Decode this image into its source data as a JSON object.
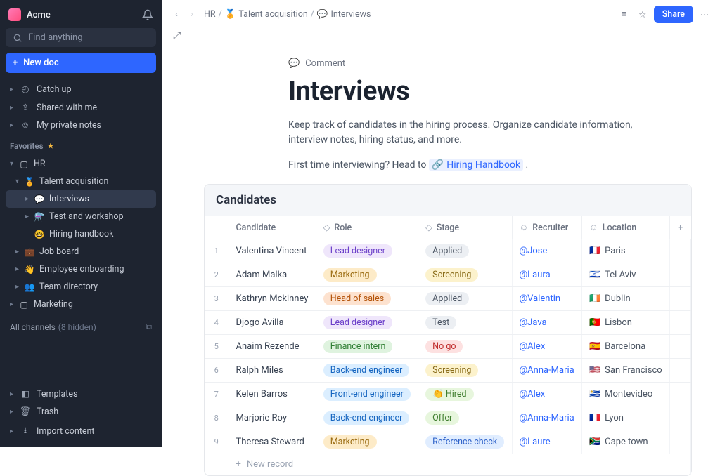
{
  "workspace": {
    "name": "Acme"
  },
  "search": {
    "placeholder": "Find anything"
  },
  "new_doc_label": "New doc",
  "nav": {
    "catch_up": "Catch up",
    "shared": "Shared with me",
    "private": "My private notes"
  },
  "favorites_label": "Favorites",
  "tree": {
    "hr": "HR",
    "talent": "Talent acquisition",
    "interviews": "Interviews",
    "test_workshop": "Test and workshop",
    "hiring_handbook": "Hiring handbook",
    "job_board": "Job board",
    "onboarding": "Employee onboarding",
    "team_directory": "Team directory",
    "marketing": "Marketing"
  },
  "all_channels": {
    "label": "All channels",
    "hidden": "(8 hidden)"
  },
  "footer": {
    "templates": "Templates",
    "trash": "Trash",
    "import": "Import content"
  },
  "breadcrumbs": {
    "seg1": "HR",
    "seg2": "Talent acquisition",
    "seg3": "Interviews"
  },
  "share_label": "Share",
  "comment_label": "Comment",
  "doc_title": "Interviews",
  "doc_desc": "Keep track of candidates in the hiring process. Organize candidate information, interview notes, hiring status, and more.",
  "hint_prefix": "First time interviewing? Head to ",
  "hint_link": "Hiring Handbook",
  "table_title": "Candidates",
  "columns": {
    "candidate": "Candidate",
    "role": "Role",
    "stage": "Stage",
    "recruiter": "Recruiter",
    "location": "Location"
  },
  "rows": [
    {
      "n": "1",
      "name": "Valentina Vincent",
      "role": "Lead designer",
      "role_c": "tag-purple",
      "stage": "Applied",
      "stage_c": "tag-gray",
      "recruiter": "@Jose",
      "flag": "🇫🇷",
      "loc": "Paris"
    },
    {
      "n": "2",
      "name": "Adam Malka",
      "role": "Marketing",
      "role_c": "tag-yellow",
      "stage": "Screening",
      "stage_c": "tag-lyellow",
      "recruiter": "@Laura",
      "flag": "🇮🇱",
      "loc": "Tel Aviv"
    },
    {
      "n": "3",
      "name": "Kathryn Mckinney",
      "role": "Head of sales",
      "role_c": "tag-orange",
      "stage": "Applied",
      "stage_c": "tag-gray",
      "recruiter": "@Valentin",
      "flag": "🇮🇪",
      "loc": "Dublin"
    },
    {
      "n": "4",
      "name": "Djogo Avilla",
      "role": "Lead designer",
      "role_c": "tag-purple",
      "stage": "Test",
      "stage_c": "tag-gray",
      "recruiter": "@Java",
      "flag": "🇵🇹",
      "loc": "Lisbon"
    },
    {
      "n": "5",
      "name": "Anaim Rezende",
      "role": "Finance intern",
      "role_c": "tag-green",
      "stage": "No go",
      "stage_c": "tag-red",
      "recruiter": "@Alex",
      "flag": "🇪🇸",
      "loc": "Barcelona"
    },
    {
      "n": "6",
      "name": "Ralph Miles",
      "role": "Back-end engineer",
      "role_c": "tag-blue",
      "stage": "Screening",
      "stage_c": "tag-lyellow",
      "recruiter": "@Anna-Maria",
      "flag": "🇺🇸",
      "loc": "San Francisco"
    },
    {
      "n": "7",
      "name": "Kelen Barros",
      "role": "Front-end engineer",
      "role_c": "tag-blue",
      "stage": "👏 Hired",
      "stage_c": "tag-lgreen",
      "recruiter": "@Alex",
      "flag": "🇺🇾",
      "loc": "Montevideo"
    },
    {
      "n": "8",
      "name": "Marjorie Roy",
      "role": "Back-end engineer",
      "role_c": "tag-blue",
      "stage": "Offer",
      "stage_c": "tag-lgreen",
      "recruiter": "@Anna-Maria",
      "flag": "🇫🇷",
      "loc": "Lyon"
    },
    {
      "n": "9",
      "name": "Theresa Steward",
      "role": "Marketing",
      "role_c": "tag-yellow",
      "stage": "Reference check",
      "stage_c": "tag-lblue",
      "recruiter": "@Laure",
      "flag": "🇿🇦",
      "loc": "Cape town"
    }
  ],
  "new_record": "New record"
}
